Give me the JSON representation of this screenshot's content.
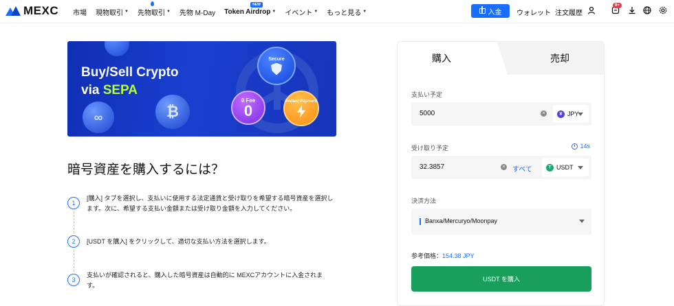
{
  "brand": {
    "name": "MEXC"
  },
  "nav": {
    "items": [
      {
        "label": "市場",
        "caret": false
      },
      {
        "label": "現物取引",
        "caret": true
      },
      {
        "label": "先物取引",
        "caret": true
      },
      {
        "label": "先物 M-Day",
        "caret": false
      },
      {
        "label": "Token Airdrop",
        "caret": true,
        "badge": "NEW"
      },
      {
        "label": "イベント",
        "caret": true
      },
      {
        "label": "もっと見る",
        "caret": true
      }
    ],
    "deposit_label": "入金",
    "wallet_label": "ウォレット",
    "orders_label": "注文履歴",
    "notification_count": "9+"
  },
  "banner": {
    "line1": "Buy/Sell Crypto",
    "line2_prefix": "via ",
    "line2_highlight": "SEPA",
    "badge_secure": "Secure",
    "badge_fee_label": "0 Fee",
    "badge_fee_value": "0",
    "badge_instant": "Instant Payment"
  },
  "howto": {
    "title": "暗号資産を購入するには？",
    "steps": [
      {
        "num": "1",
        "text": "[購入] タブを選択し、支払いに使用する法定通貨と受け取りを希望する暗号資産を選択します。次に、希望する支払い金額または受け取り金額を入力してください。"
      },
      {
        "num": "2",
        "text": "[USDT を購入] をクリックして、適切な支払い方法を選択します。"
      },
      {
        "num": "3",
        "text": "支払いが確認されると、購入した暗号資産は自動的に MEXCアカウントに入金されます。"
      }
    ]
  },
  "trade": {
    "tab_buy": "購入",
    "tab_sell": "売却",
    "pay_label": "支払い予定",
    "pay_amount": "5000",
    "pay_currency": "JPY",
    "receive_label": "受け取り予定",
    "receive_amount": "32.3857",
    "receive_all": "すべて",
    "receive_currency": "USDT",
    "timer": "14s",
    "method_label": "決済方法",
    "method_value": "Banxa/Mercuryo/Moonpay",
    "ref_label": "参考価格：",
    "ref_value": "154.38 JPY",
    "buy_button": "USDT を購入"
  },
  "colors": {
    "accent": "#1a6eff",
    "buy": "#1a9e5c",
    "badge": "#e83a4a"
  }
}
